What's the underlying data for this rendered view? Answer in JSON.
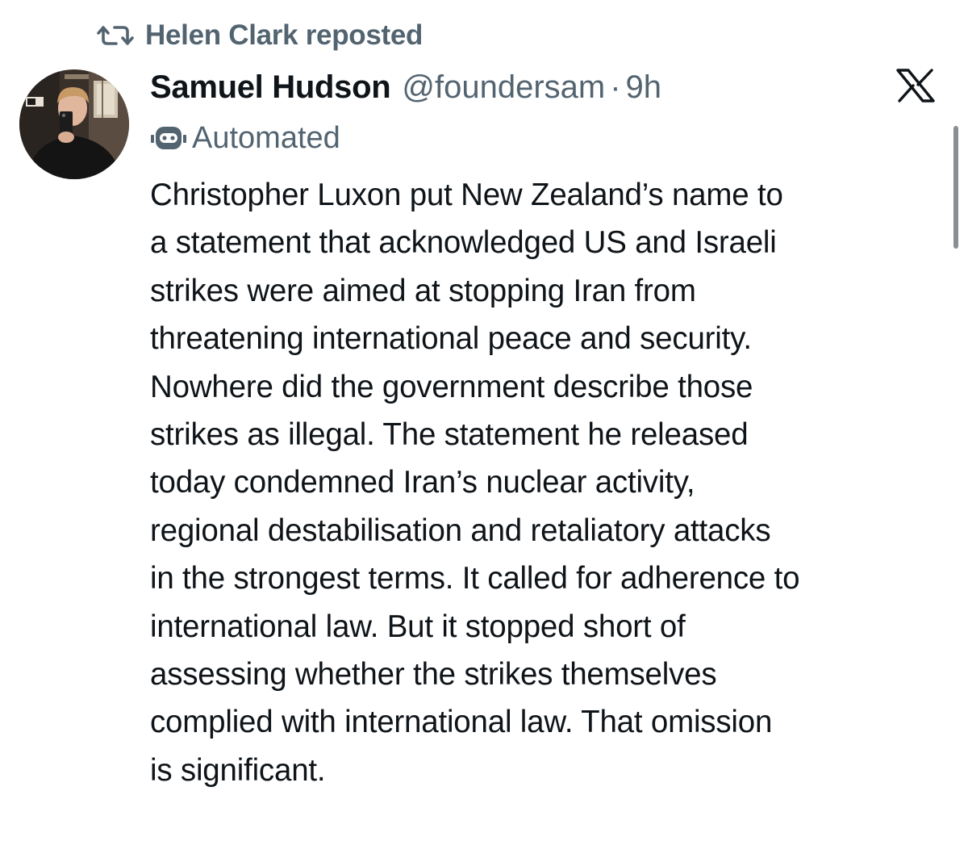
{
  "repost": {
    "icon": "repost-icon",
    "text": "Helen Clark reposted"
  },
  "author": {
    "avatar": "avatar-photo",
    "name": "Samuel Hudson",
    "handle": "@foundersam",
    "separator": "·",
    "time": "9h"
  },
  "platform_icon": "x-logo-icon",
  "label": {
    "icon": "bot-icon",
    "text": "Automated"
  },
  "tweet": {
    "text": "Christopher Luxon put New Zealand’s name to\na statement that acknowledged US and Israeli\nstrikes were aimed at stopping Iran from\nthreatening international peace and security.\nNowhere did the government describe those\nstrikes as illegal. The statement he released\ntoday condemned Iran’s nuclear activity,\nregional destabilisation and retaliatory attacks\nin the strongest terms. It called for adherence to\ninternational law. But it stopped short of\nassessing whether the strikes themselves\ncomplied with international law. That omission\nis significant."
  },
  "colors": {
    "primary_text": "#0f1419",
    "secondary_text": "#536471",
    "background": "#ffffff"
  }
}
